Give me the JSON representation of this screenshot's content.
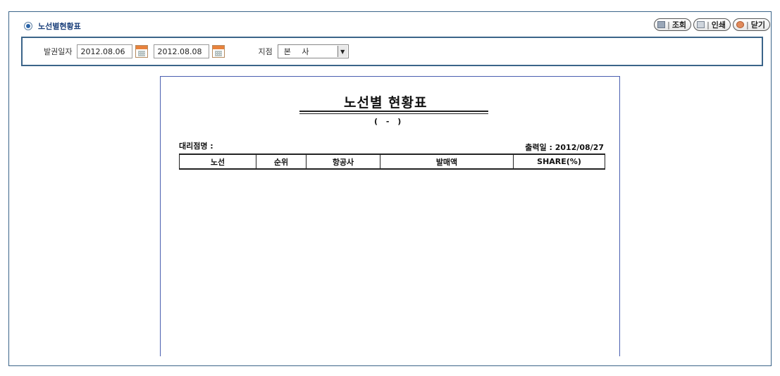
{
  "header": {
    "title": "노선별현황표"
  },
  "toolbar": {
    "search_label": "조회",
    "print_label": "인쇄",
    "close_label": "닫기",
    "separator": "|"
  },
  "filters": {
    "issue_date_label": "발권일자",
    "date_from": "2012.08.06",
    "date_to": "2012.08.08",
    "branch_label": "지점",
    "branch_value": "본 사"
  },
  "report": {
    "title": "노선별 현황표",
    "subtitle": "( - )",
    "agency_label": "대리점명 :",
    "print_date_label": "출력일 :",
    "print_date": "2012/08/27",
    "columns": [
      "노선",
      "순위",
      "항공사",
      "발매액",
      "SHARE(%)"
    ]
  },
  "colors": {
    "border": "#3b6489",
    "title": "#1a3f7a",
    "report_border": "#4a5fb0"
  },
  "icons": [
    "radio-icon",
    "search-icon",
    "print-icon",
    "close-icon",
    "calendar-icon",
    "dropdown-arrow-icon"
  ]
}
